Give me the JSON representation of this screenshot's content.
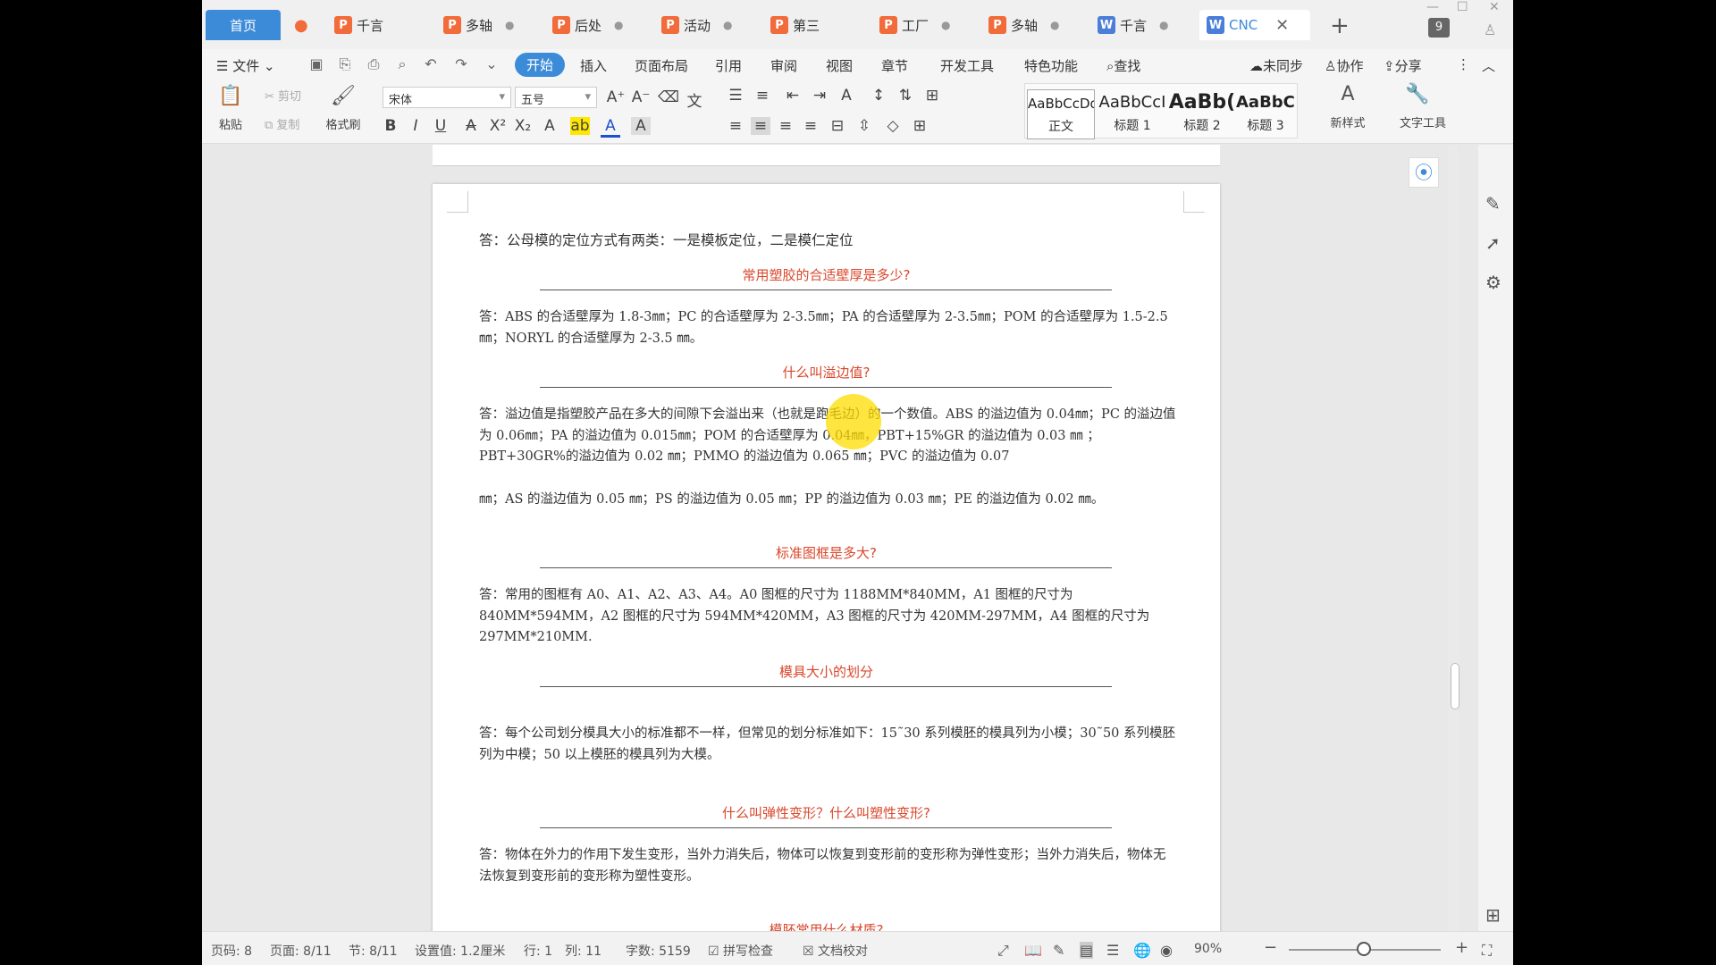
{
  "tabs": [
    {
      "label": "首页",
      "type": "home"
    },
    {
      "label": "",
      "type": "fire"
    },
    {
      "label": "千言",
      "type": "p"
    },
    {
      "label": "多轴",
      "type": "p"
    },
    {
      "label": "后处",
      "type": "p"
    },
    {
      "label": "活动",
      "type": "p"
    },
    {
      "label": "第三",
      "type": "p"
    },
    {
      "label": "工厂",
      "type": "p"
    },
    {
      "label": "多轴",
      "type": "p"
    },
    {
      "label": "千言",
      "type": "w"
    },
    {
      "label": "CNC",
      "type": "w"
    }
  ],
  "tab_badge": "9",
  "menu": {
    "file": "文件",
    "items": [
      "开始",
      "插入",
      "页面布局",
      "引用",
      "审阅",
      "视图",
      "章节",
      "开发工具",
      "特色功能"
    ],
    "search": "查找",
    "sync": "未同步",
    "collab": "协作",
    "share": "分享"
  },
  "ribbon": {
    "paste": "粘贴",
    "cut": "剪切",
    "copy": "复制",
    "format_painter": "格式刷",
    "font": "宋体",
    "size": "五号",
    "styles": [
      {
        "preview": "AaBbCcDd",
        "label": "正文"
      },
      {
        "preview": "AaBbCcI",
        "label": "标题 1"
      },
      {
        "preview": "AaBb(",
        "label": "标题 2"
      },
      {
        "preview": "AaBbCc",
        "label": "标题 3"
      }
    ],
    "new_style": "新样式",
    "text_tools": "文字工具"
  },
  "doc": {
    "sections": [
      {
        "type": "answer",
        "text": "答：公母模的定位方式有两类：一是模板定位，二是模仁定位"
      },
      {
        "type": "heading",
        "text": "常用塑胶的合适壁厚是多少?"
      },
      {
        "type": "answer",
        "text": "答：ABS 的合适壁厚为 1.8-3㎜；PC 的合适壁厚为 2-3.5㎜；PA 的合适壁厚为 2-3.5㎜；POM 的合适壁厚为 1.5-2.5㎜；NORYL 的合适壁厚为 2-3.5 ㎜。"
      },
      {
        "type": "heading",
        "text": "什么叫溢边值?"
      },
      {
        "type": "answer",
        "text": "答：溢边值是指塑胶产品在多大的间隙下会溢出来（也就是跑毛边）的一个数值。ABS 的溢边值为 0.04㎜；PC 的溢边值为 0.06㎜；PA 的溢边值为 0.015㎜；POM 的合适壁厚为 0.04㎜，PBT+15%GR 的溢边值为 0.03 ㎜ ；PBT+30GR%的溢边值为 0.02 ㎜；PMMO 的溢边值为 0.065 ㎜；PVC 的溢边值为 0.07"
      },
      {
        "type": "answer",
        "text": "㎜；AS 的溢边值为 0.05 ㎜；PS 的溢边值为 0.05 ㎜；PP 的溢边值为 0.03 ㎜；PE 的溢边值为 0.02 ㎜。"
      },
      {
        "type": "heading",
        "text": "标准图框是多大?"
      },
      {
        "type": "answer",
        "text": "答：常用的图框有 A0、A1、A2、A3、A4。A0 图框的尺寸为 1188MM*840MM，A1 图框的尺寸为 840MM*594MM，A2 图框的尺寸为 594MM*420MM，A3 图框的尺寸为 420MM-297MM，A4 图框的尺寸为 297MM*210MM."
      },
      {
        "type": "heading",
        "text": "模具大小的划分"
      },
      {
        "type": "answer",
        "text": "答：每个公司划分模具大小的标准都不一样，但常见的划分标准如下：15˜30 系列模胚的模具列为小模；30˜50 系列模胚列为中模；50 以上模胚的模具列为大模。"
      },
      {
        "type": "heading",
        "text": "什么叫弹性变形？什么叫塑性变形?"
      },
      {
        "type": "answer",
        "text": "答：物体在外力的作用下发生变形，当外力消失后，物体可以恢复到变形前的变形称为弹性变形；当外力消失后，物体无法恢复到变形前的变形称为塑性变形。"
      },
      {
        "type": "heading",
        "text": "模胚常用什么材质?"
      }
    ]
  },
  "status": {
    "page_code": "页码: 8",
    "page": "页面: 8/11",
    "section": "节: 8/11",
    "setting": "设置值: 1.2厘米",
    "row": "行: 1",
    "col": "列: 11",
    "words": "字数: 5159",
    "spell": "拼写检查",
    "proof": "文档校对",
    "zoom": "90%"
  },
  "colors": {
    "accent": "#3c8bd9",
    "heading": "#d9472b"
  }
}
